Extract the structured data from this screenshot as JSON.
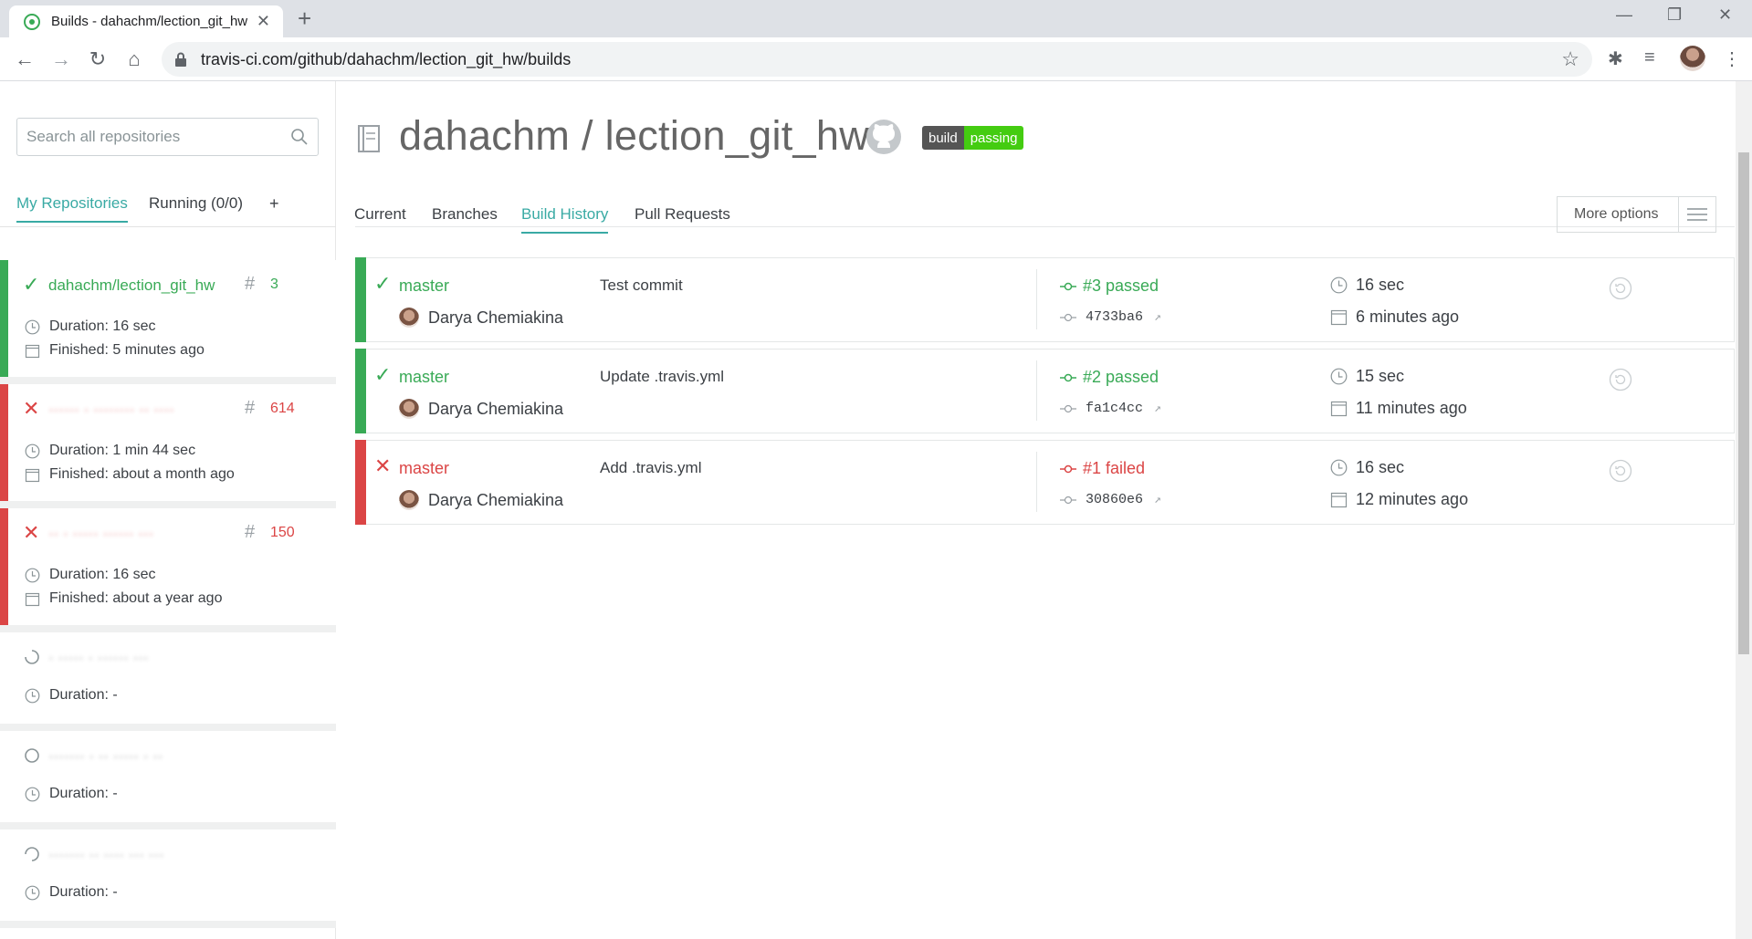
{
  "browser": {
    "tab_title": "Builds - dahachm/lection_git_hw",
    "url": "travis-ci.com/github/dahachm/lection_git_hw/builds"
  },
  "sidebar": {
    "search_placeholder": "Search all repositories",
    "tabs": [
      {
        "label": "My Repositories",
        "active": true
      },
      {
        "label": "Running (0/0)",
        "active": false
      },
      {
        "label": "+",
        "active": false
      }
    ],
    "repos": [
      {
        "name": "dahachm/lection_git_hw",
        "number": "3",
        "status": "passed",
        "duration": "Duration: 16 sec",
        "finished": "Finished: 5 minutes ago"
      },
      {
        "name": "hidden repository",
        "number": "614",
        "status": "failed",
        "duration": "Duration: 1 min 44 sec",
        "finished": "Finished: about a month ago"
      },
      {
        "name": "hidden repository",
        "number": "150",
        "status": "failed",
        "duration": "Duration: 16 sec",
        "finished": "Finished: about a year ago"
      },
      {
        "name": "hidden repository",
        "number": "",
        "status": "none",
        "duration": "Duration: -",
        "finished": ""
      },
      {
        "name": "hidden repository",
        "number": "",
        "status": "none",
        "duration": "Duration: -",
        "finished": ""
      },
      {
        "name": "hidden repository",
        "number": "",
        "status": "none",
        "duration": "Duration: -",
        "finished": ""
      }
    ]
  },
  "main": {
    "owner": "dahachm",
    "repo": "lection_git_hw",
    "title": "dahachm / lection_git_hw",
    "badge": {
      "left": "build",
      "right": "passing"
    },
    "tabs": [
      "Current",
      "Branches",
      "Build History",
      "Pull Requests"
    ],
    "active_tab": "Build History",
    "more_options": "More options",
    "builds": [
      {
        "branch": "master",
        "author": "Darya Chemiakina",
        "message": "Test commit",
        "result": "#3 passed",
        "commit": "4733ba6",
        "duration": "16 sec",
        "finished": "6 minutes ago",
        "status": "passed"
      },
      {
        "branch": "master",
        "author": "Darya Chemiakina",
        "message": "Update .travis.yml",
        "result": "#2 passed",
        "commit": "fa1c4cc",
        "duration": "15 sec",
        "finished": "11 minutes ago",
        "status": "passed"
      },
      {
        "branch": "master",
        "author": "Darya Chemiakina",
        "message": "Add .travis.yml",
        "result": "#1 failed",
        "commit": "30860e6",
        "duration": "16 sec",
        "finished": "12 minutes ago",
        "status": "failed"
      }
    ]
  },
  "colors": {
    "passed": "#39aa56",
    "failed": "#db4545",
    "accent": "#39aaa4",
    "badge_dark": "#555555",
    "badge_green": "#4c1"
  }
}
